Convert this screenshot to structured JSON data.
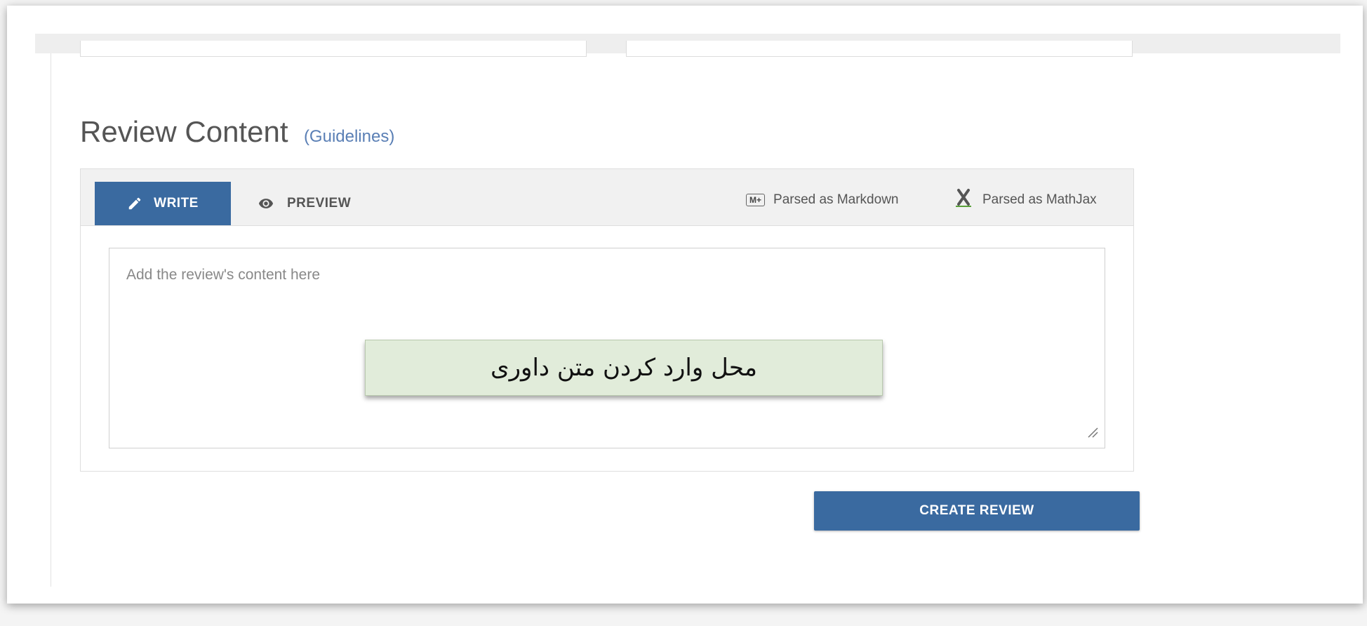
{
  "review": {
    "heading": "Review Content",
    "guidelines_link": "(Guidelines)"
  },
  "editor": {
    "tabs": [
      {
        "label": "WRITE",
        "icon": "pencil-icon",
        "active": true
      },
      {
        "label": "PREVIEW",
        "icon": "eye-icon",
        "active": false
      }
    ],
    "parsers": [
      {
        "label": "Parsed as Markdown",
        "icon": "markdown-icon",
        "badge": "M+"
      },
      {
        "label": "Parsed as MathJax",
        "icon": "mathjax-icon"
      }
    ],
    "placeholder": "Add the review's content here",
    "value": ""
  },
  "annotation": {
    "text": "محل وارد کردن متن داوری"
  },
  "actions": {
    "create_label": "CREATE REVIEW"
  },
  "colors": {
    "accent": "#3a6aa0",
    "annotation_bg": "#e1ecda",
    "link": "#5a7fb5"
  }
}
